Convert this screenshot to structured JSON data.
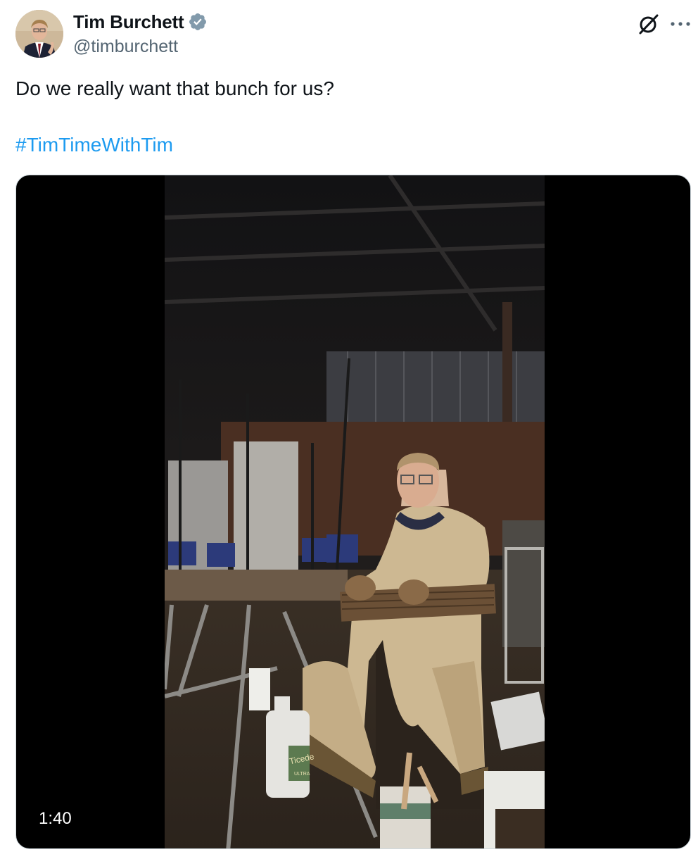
{
  "author": {
    "name": "Tim Burchett",
    "handle": "@timburchett",
    "verified": true,
    "verified_color": "#829aab",
    "avatar_icon": "avatar-photo"
  },
  "header_actions": {
    "grok_icon": "grok-icon",
    "more_icon": "more-options-icon"
  },
  "tweet": {
    "text": "Do we really want that bunch for us?",
    "hashtag": "#TimTimeWithTim",
    "link_color": "#1d9bf0"
  },
  "video": {
    "duration": "1:40",
    "bottle_label": "Ticede",
    "bottle_sub": "ULTRA"
  }
}
